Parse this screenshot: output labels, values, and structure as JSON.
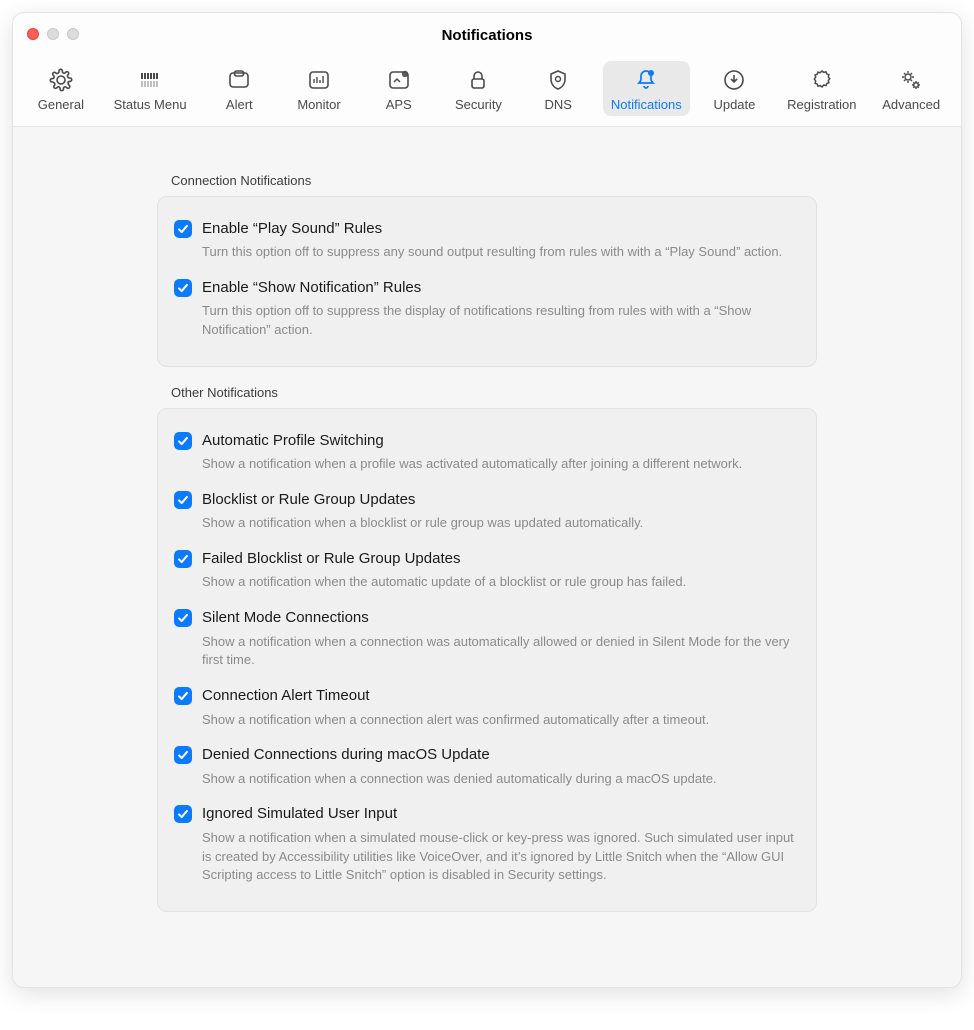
{
  "window": {
    "title": "Notifications"
  },
  "toolbar": {
    "items": [
      {
        "label": "General",
        "icon": "gear-icon",
        "selected": false
      },
      {
        "label": "Status Menu",
        "icon": "bars-icon",
        "selected": false
      },
      {
        "label": "Alert",
        "icon": "alert-window-icon",
        "selected": false
      },
      {
        "label": "Monitor",
        "icon": "monitor-icon",
        "selected": false
      },
      {
        "label": "APS",
        "icon": "aps-icon",
        "selected": false
      },
      {
        "label": "Security",
        "icon": "lock-icon",
        "selected": false
      },
      {
        "label": "DNS",
        "icon": "shield-icon",
        "selected": false
      },
      {
        "label": "Notifications",
        "icon": "bell-icon",
        "selected": true
      },
      {
        "label": "Update",
        "icon": "download-icon",
        "selected": false
      },
      {
        "label": "Registration",
        "icon": "badge-icon",
        "selected": false
      },
      {
        "label": "Advanced",
        "icon": "gears-icon",
        "selected": false
      }
    ]
  },
  "sections": [
    {
      "label": "Connection Notifications",
      "rows": [
        {
          "checked": true,
          "title": "Enable “Play Sound” Rules",
          "desc": "Turn this option off to suppress any sound output resulting from rules with with a “Play Sound” action."
        },
        {
          "checked": true,
          "title": "Enable “Show Notification” Rules",
          "desc": "Turn this option off to suppress the display of notifications resulting from rules with with a “Show Notification” action."
        }
      ]
    },
    {
      "label": "Other Notifications",
      "rows": [
        {
          "checked": true,
          "title": "Automatic Profile Switching",
          "desc": "Show a notification when a profile was activated automatically after joining a different network."
        },
        {
          "checked": true,
          "title": "Blocklist or Rule Group Updates",
          "desc": "Show a notification when a blocklist or rule group was updated automatically."
        },
        {
          "checked": true,
          "title": "Failed Blocklist or Rule Group Updates",
          "desc": "Show a notification when the automatic update of a blocklist or rule group has failed."
        },
        {
          "checked": true,
          "title": "Silent Mode Connections",
          "desc": "Show a notification when a connection was automatically allowed or denied in Silent Mode for the very first time."
        },
        {
          "checked": true,
          "title": "Connection Alert Timeout",
          "desc": "Show a notification when a connection alert was confirmed automatically after a timeout."
        },
        {
          "checked": true,
          "title": "Denied Connections during macOS Update",
          "desc": "Show a notification when a connection was denied automatically during a macOS update."
        },
        {
          "checked": true,
          "title": "Ignored Simulated User Input",
          "desc": "Show a notification when a simulated mouse-click or key-press was ignored. Such simulated user input is created by Accessibility utilities like VoiceOver, and it’s ignored by Little Snitch when the “Allow GUI Scripting access to Little Snitch” option is disabled in Security settings."
        }
      ]
    }
  ]
}
